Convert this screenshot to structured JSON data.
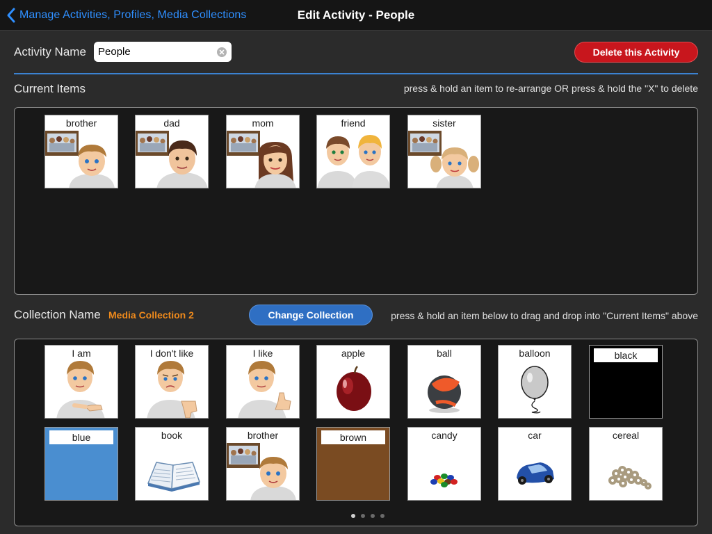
{
  "nav": {
    "back_label": "Manage Activities, Profiles, Media Collections",
    "title": "Edit Activity - People"
  },
  "activity": {
    "name_label": "Activity Name",
    "name_value": "People",
    "delete_label": "Delete this Activity"
  },
  "current": {
    "label": "Current Items",
    "hint": "press & hold an item to re-arrange OR press & hold the \"X\" to delete",
    "items": [
      {
        "label": "brother",
        "icon": "brother-picture"
      },
      {
        "label": "dad",
        "icon": "dad-picture"
      },
      {
        "label": "mom",
        "icon": "mom-picture"
      },
      {
        "label": "friend",
        "icon": "friend-picture"
      },
      {
        "label": "sister",
        "icon": "sister-picture"
      }
    ]
  },
  "collection": {
    "label": "Collection Name",
    "name": "Media Collection 2",
    "change_label": "Change Collection",
    "hint": "press & hold an item below to drag and drop into \"Current Items\" above",
    "items": [
      {
        "label": "I am",
        "icon": "boy-pointing-self"
      },
      {
        "label": "I don't like",
        "icon": "boy-thumbs-down"
      },
      {
        "label": "I like",
        "icon": "boy-thumbs-up"
      },
      {
        "label": "apple",
        "icon": "apple-photo"
      },
      {
        "label": "ball",
        "icon": "ball-photo"
      },
      {
        "label": "balloon",
        "icon": "balloon-drawing"
      },
      {
        "label": "black",
        "icon": "color-swatch",
        "color": "#000000"
      },
      {
        "label": "blue",
        "icon": "color-swatch",
        "color": "#4a8ed0"
      },
      {
        "label": "book",
        "icon": "book-drawing"
      },
      {
        "label": "brother",
        "icon": "brother-picture"
      },
      {
        "label": "brown",
        "icon": "color-swatch",
        "color": "#7a4b22"
      },
      {
        "label": "candy",
        "icon": "candy-photo"
      },
      {
        "label": "car",
        "icon": "toy-car-photo"
      },
      {
        "label": "cereal",
        "icon": "cereal-photo"
      }
    ]
  },
  "pager": {
    "pages": 4,
    "current": 1
  },
  "colors": {
    "accent": "#2f8fff",
    "delete": "#c8161d",
    "change": "#2f6fc3",
    "collection_name": "#ef8a1c"
  }
}
